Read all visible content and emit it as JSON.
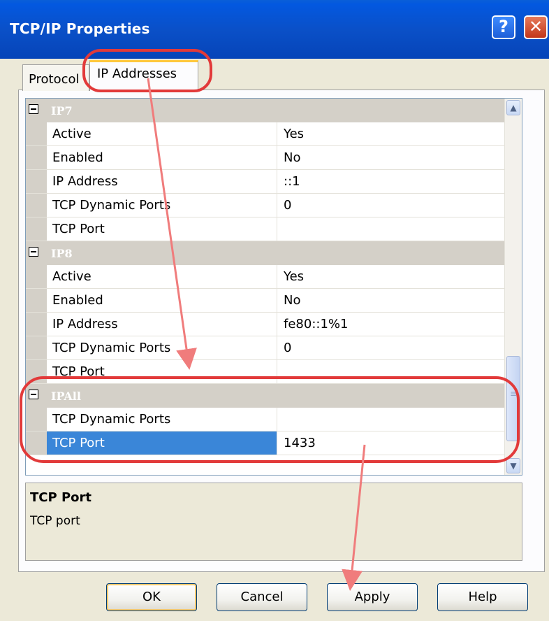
{
  "window": {
    "title": "TCP/IP Properties",
    "help_glyph": "?",
    "close_glyph": "✕"
  },
  "tabs": [
    {
      "label": "Protocol"
    },
    {
      "label": "IP Addresses"
    }
  ],
  "groups": [
    {
      "name": "IP7",
      "props": [
        {
          "name": "Active",
          "value": "Yes"
        },
        {
          "name": "Enabled",
          "value": "No"
        },
        {
          "name": "IP Address",
          "value": "::1"
        },
        {
          "name": "TCP Dynamic Ports",
          "value": "0"
        },
        {
          "name": "TCP Port",
          "value": ""
        }
      ]
    },
    {
      "name": "IP8",
      "props": [
        {
          "name": "Active",
          "value": "Yes"
        },
        {
          "name": "Enabled",
          "value": "No"
        },
        {
          "name": "IP Address",
          "value": "fe80::1%1"
        },
        {
          "name": "TCP Dynamic Ports",
          "value": "0"
        },
        {
          "name": "TCP Port",
          "value": ""
        }
      ]
    },
    {
      "name": "IPAll",
      "props": [
        {
          "name": "TCP Dynamic Ports",
          "value": ""
        },
        {
          "name": "TCP Port",
          "value": "1433",
          "selected": true
        }
      ]
    }
  ],
  "description": {
    "title": "TCP Port",
    "text": "TCP port"
  },
  "buttons": {
    "ok": "OK",
    "cancel": "Cancel",
    "apply": "Apply",
    "help": "Help"
  },
  "colors": {
    "titlebar": "#0A50C8",
    "selection": "#3A86D8",
    "annotation": "#E23A3A",
    "arrow": "#F07C7C"
  }
}
